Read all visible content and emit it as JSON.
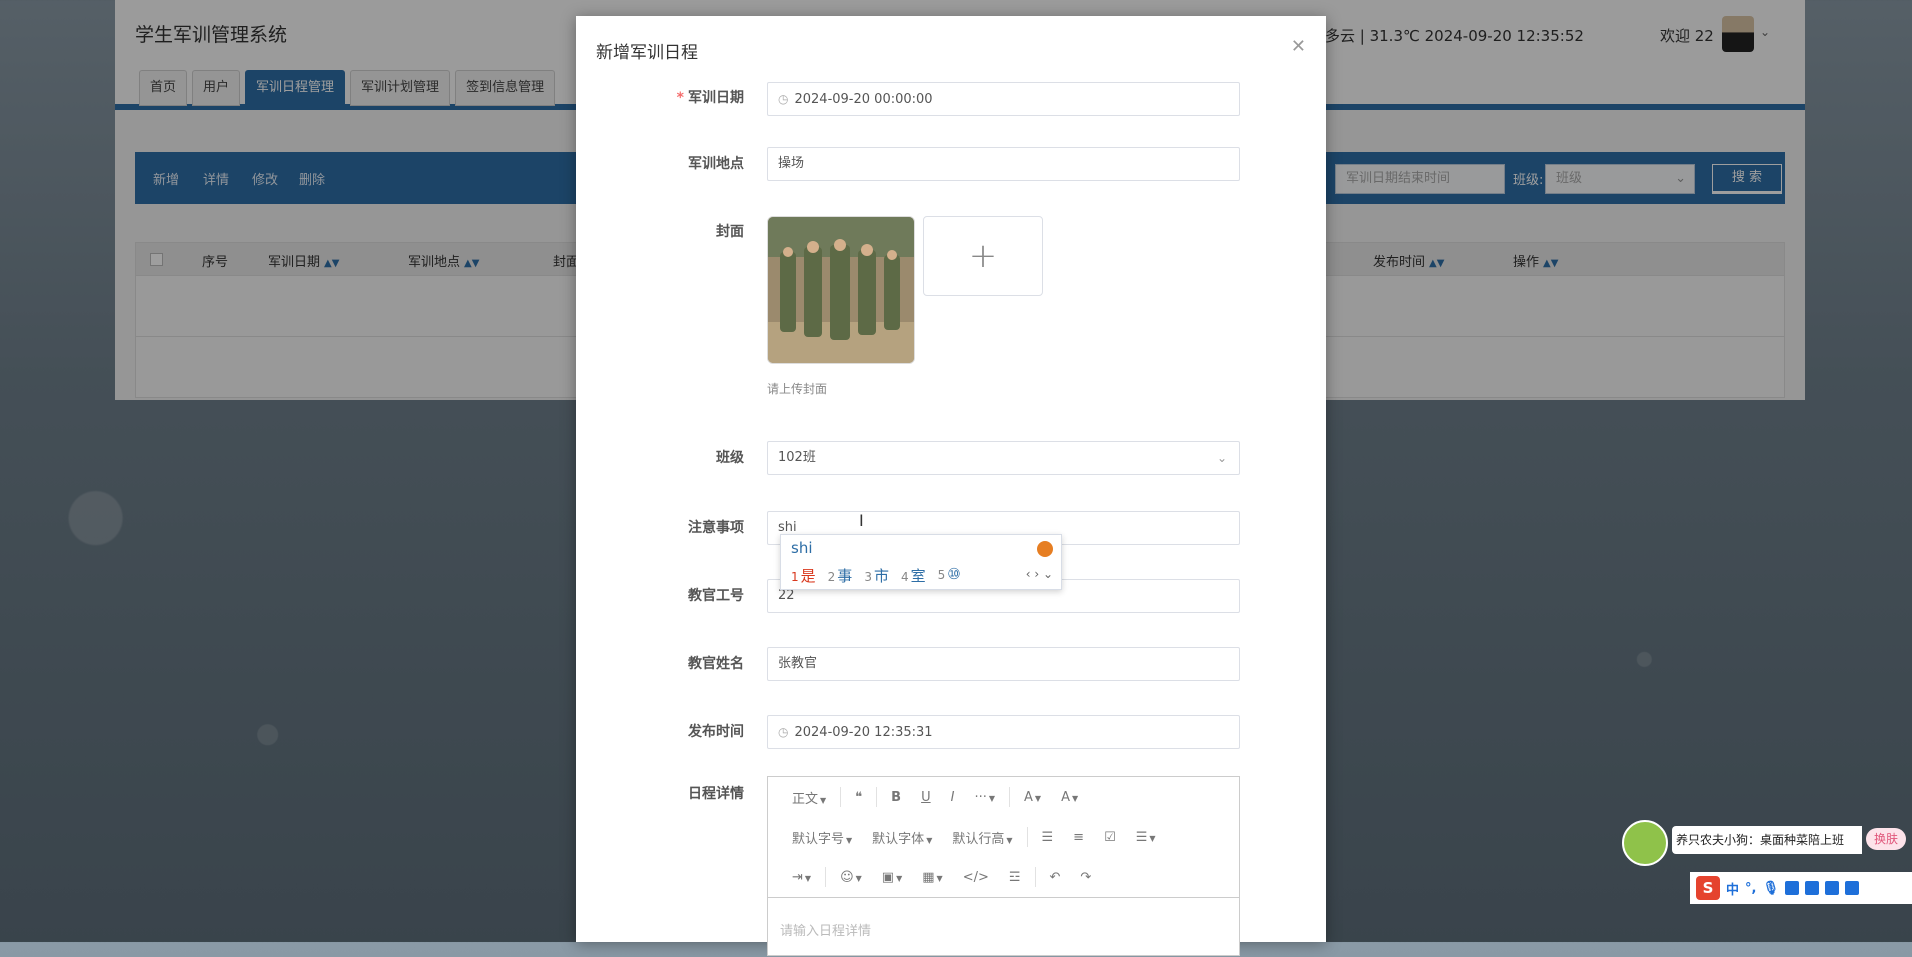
{
  "app": {
    "title": "学生军训管理系统",
    "weather": "多云 | 31.3℃    2024-09-20  12:35:52",
    "welcome": "欢迎 22",
    "nav_tabs": [
      "首页",
      "用户",
      "军训日程管理",
      "军训计划管理",
      "签到信息管理"
    ],
    "active_tab_index": 2
  },
  "action_bar": {
    "buttons": [
      "新增",
      "详情",
      "修改",
      "删除"
    ],
    "filter_end_date_placeholder": "军训日期结束时间",
    "class_label": "班级:",
    "class_placeholder": "班级",
    "search_label": "搜 索"
  },
  "table": {
    "headers": [
      "序号",
      "军训日期",
      "军训地点",
      "封面",
      "发布时间",
      "操作"
    ]
  },
  "dialog": {
    "title": "新增军训日程",
    "close_icon": "close-icon",
    "fields": {
      "date": {
        "label": "军训日期",
        "value": "2024-09-20 00:00:00",
        "required": true
      },
      "location": {
        "label": "军训地点",
        "value": "操场"
      },
      "cover": {
        "label": "封面",
        "hint": "请上传封面"
      },
      "class": {
        "label": "班级",
        "value": "102班"
      },
      "notes": {
        "label": "注意事项",
        "value": "shi"
      },
      "instructor_id": {
        "label": "教官工号",
        "value": "22"
      },
      "instructor_name": {
        "label": "教官姓名",
        "value": "张教官"
      },
      "publish_time": {
        "label": "发布时间",
        "value": "2024-09-20 12:35:31"
      },
      "details": {
        "label": "日程详情",
        "placeholder": "请输入日程详情"
      }
    },
    "editor_toolbar": {
      "row1": [
        "正文",
        "❝",
        "B",
        "U",
        "I",
        "···",
        "A",
        "A"
      ],
      "row2": [
        "默认字号",
        "默认字体",
        "默认行高"
      ],
      "row3_icons": [
        "indent-icon",
        "emoji-icon",
        "image-icon",
        "table-icon",
        "code-icon",
        "divider-icon",
        "undo-icon",
        "redo-icon"
      ]
    }
  },
  "ime": {
    "composition": "shi",
    "candidates": [
      {
        "n": "1",
        "text": "是"
      },
      {
        "n": "2",
        "text": "事"
      },
      {
        "n": "3",
        "text": "市"
      },
      {
        "n": "4",
        "text": "室"
      },
      {
        "n": "5",
        "text": "⑩"
      }
    ]
  },
  "sogou": {
    "ticker": "养只农夫小狗：桌面种菜陪上班",
    "skin_label": "换肤",
    "bar_items": [
      "中",
      "°,"
    ]
  },
  "colors": {
    "primary": "#2e6ea6",
    "required": "#f56c6c",
    "ime_first": "#d9381e"
  }
}
